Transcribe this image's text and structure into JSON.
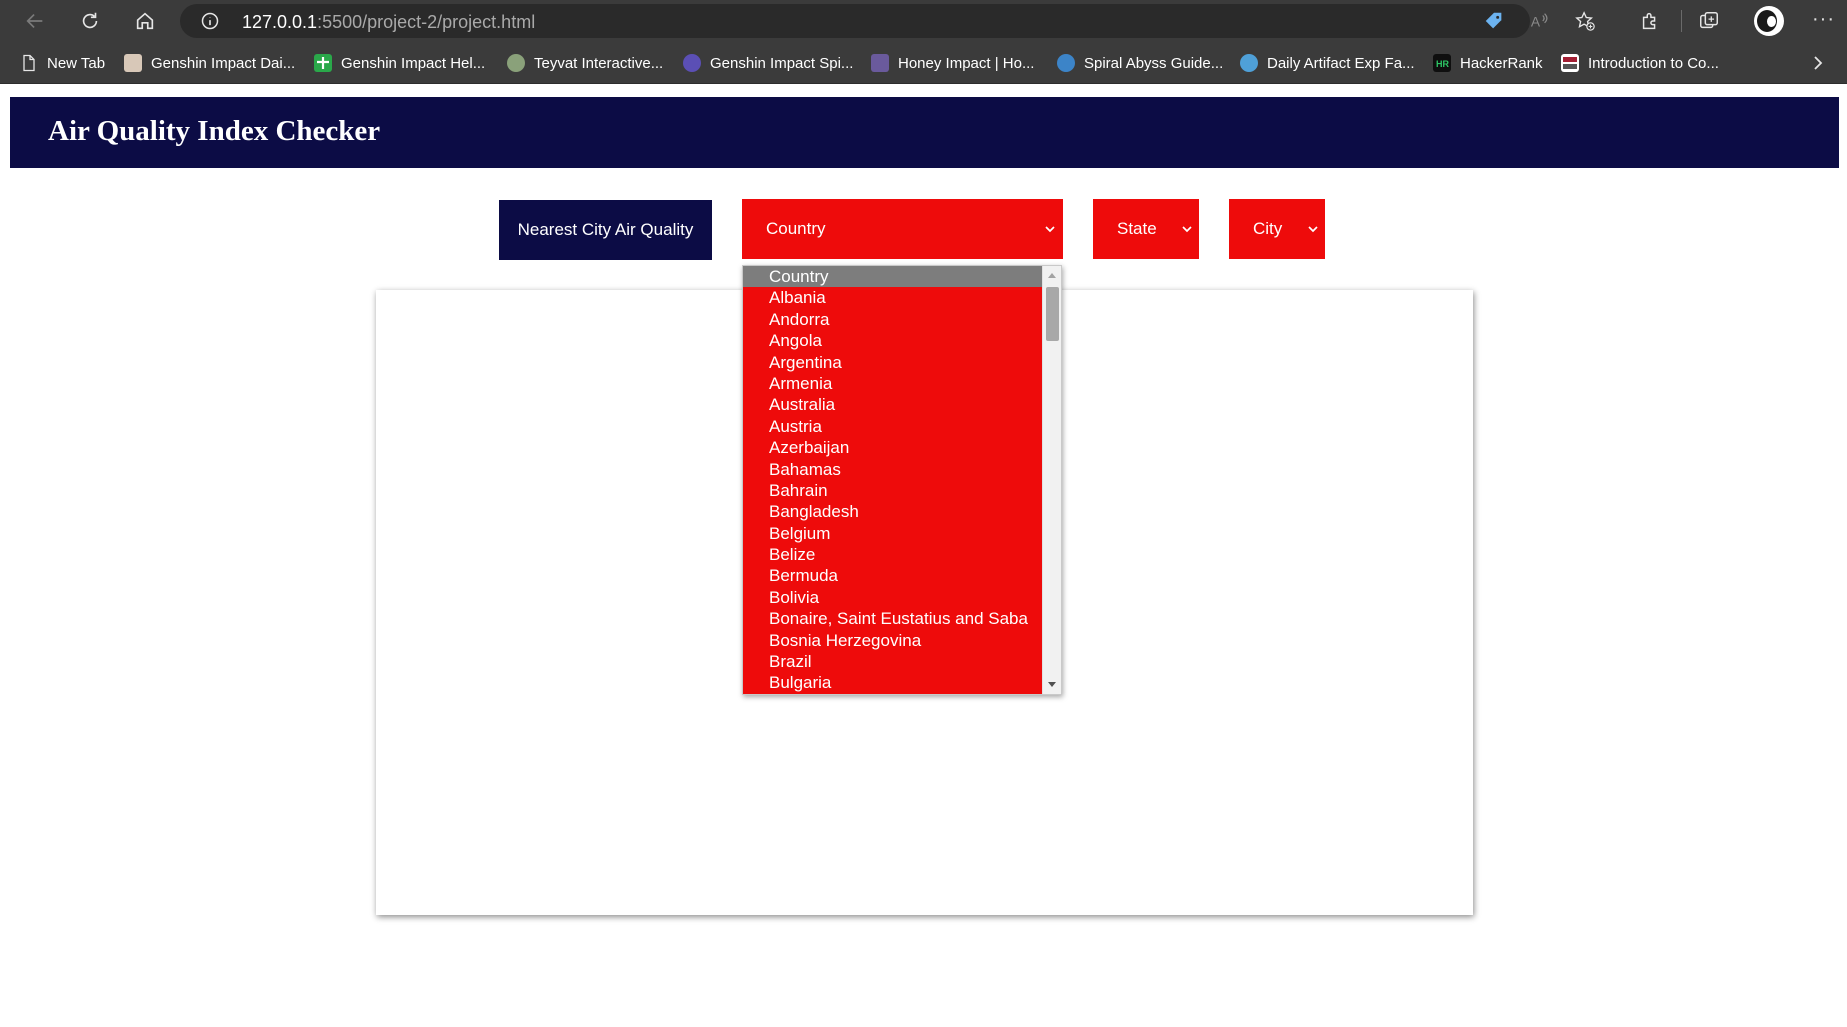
{
  "browser": {
    "url_host": "127.0.0.1",
    "url_rest": ":5500/project-2/project.html",
    "more_label": "···"
  },
  "bookmarks": [
    {
      "label": "New Tab",
      "icon": "page-icon",
      "color": "#3b3b3b"
    },
    {
      "label": "Genshin Impact Dai...",
      "icon": "genshin-daily-favicon",
      "color": "#d8c8b8"
    },
    {
      "label": "Genshin Impact Hel...",
      "icon": "plus-favicon",
      "color": "#2aa84a"
    },
    {
      "label": "Teyvat Interactive...",
      "icon": "teyvat-map-favicon",
      "color": "#8aa17a"
    },
    {
      "label": "Genshin Impact Spi...",
      "icon": "spiral-favicon",
      "color": "#5b4fb5"
    },
    {
      "label": "Honey Impact | Ho...",
      "icon": "honey-impact-favicon",
      "color": "#6a5a9c"
    },
    {
      "label": "Spiral Abyss Guide...",
      "icon": "abyss-guide-favicon",
      "color": "#3c84c8"
    },
    {
      "label": "Daily Artifact Exp Fa...",
      "icon": "artifact-favicon",
      "color": "#4fa0d8"
    },
    {
      "label": "HackerRank",
      "icon": "hackerrank-favicon",
      "color": "#0f0f0f"
    },
    {
      "label": "Introduction to Co...",
      "icon": "mit-ocw-favicon",
      "color": "#a31f34"
    }
  ],
  "app": {
    "title": "Air Quality Index Checker",
    "nearest_button": "Nearest City Air Quality",
    "country_select": "Country",
    "state_select": "State",
    "city_select": "City"
  },
  "country_options": [
    "Country",
    "Albania",
    "Andorra",
    "Angola",
    "Argentina",
    "Armenia",
    "Australia",
    "Austria",
    "Azerbaijan",
    "Bahamas",
    "Bahrain",
    "Bangladesh",
    "Belgium",
    "Belize",
    "Bermuda",
    "Bolivia",
    "Bonaire, Saint Eustatius and Saba",
    "Bosnia Herzegovina",
    "Brazil",
    "Bulgaria"
  ],
  "selected_country_index": 0,
  "colors": {
    "navy": "#0c0c45",
    "red": "#ee0b0b",
    "chrome": "#3b3b3b"
  }
}
